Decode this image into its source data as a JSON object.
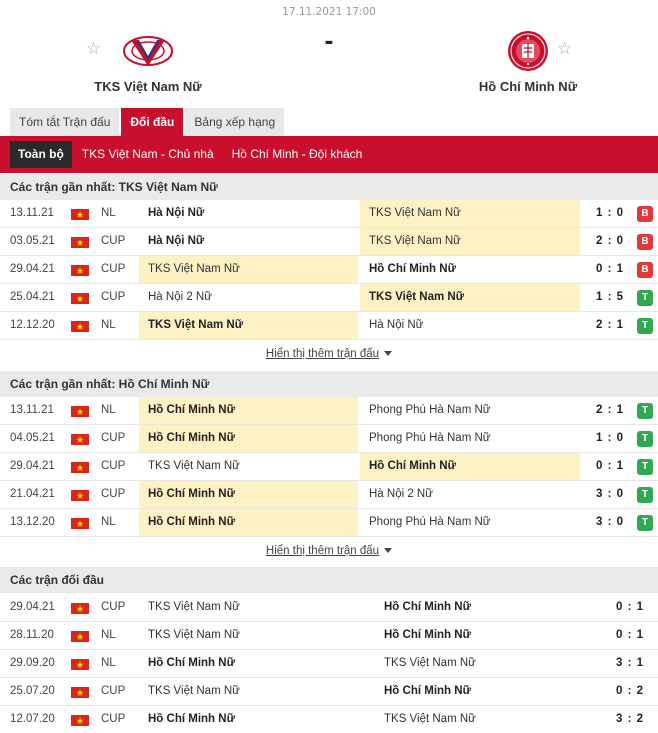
{
  "match": {
    "datetime": "17.11.2021 17:00",
    "score_separator": "-",
    "home": {
      "name": "TKS Việt Nam Nữ",
      "logo_icon": "tks-vietnam-crest-icon"
    },
    "away": {
      "name": "Hồ Chí Minh Nữ",
      "logo_icon": "hcm-football-club-crest-icon"
    }
  },
  "tabs": [
    {
      "label": "Tóm tắt Trận đấu",
      "active": false
    },
    {
      "label": "Đối đầu",
      "active": true
    },
    {
      "label": "Bảng xếp hạng",
      "active": false
    }
  ],
  "subtabs": [
    {
      "label": "Toàn bộ",
      "active": true
    },
    {
      "label": "TKS Việt Nam - Chủ nhà",
      "active": false
    },
    {
      "label": "Hồ Chí Minh - Đội khách",
      "active": false
    }
  ],
  "colors": {
    "accent": "#c8102e",
    "highlight": "#fcf2c4",
    "loss": "#e23a3a",
    "win": "#2fa84f"
  },
  "sections": {
    "home_recent": {
      "title": "Các trận gần nhất: TKS Việt Nam Nữ",
      "more_label": "Hiển thị thêm trận đấu",
      "rows": [
        {
          "date": "13.11.21",
          "comp": "NL",
          "home": "Hà Nội Nữ",
          "away": "TKS Việt Nam Nữ",
          "score": "1 : 0",
          "result": "B",
          "highlight": "away",
          "bold": "home"
        },
        {
          "date": "03.05.21",
          "comp": "CUP",
          "home": "Hà Nội Nữ",
          "away": "TKS Việt Nam Nữ",
          "score": "2 : 0",
          "result": "B",
          "highlight": "away",
          "bold": "home"
        },
        {
          "date": "29.04.21",
          "comp": "CUP",
          "home": "TKS Việt Nam Nữ",
          "away": "Hồ Chí Minh Nữ",
          "score": "0 : 1",
          "result": "B",
          "highlight": "home",
          "bold": "away"
        },
        {
          "date": "25.04.21",
          "comp": "CUP",
          "home": "Hà Nội 2 Nữ",
          "away": "TKS Việt Nam Nữ",
          "score": "1 : 5",
          "result": "T",
          "highlight": "away",
          "bold": "away"
        },
        {
          "date": "12.12.20",
          "comp": "NL",
          "home": "TKS Việt Nam Nữ",
          "away": "Hà Nội Nữ",
          "score": "2 : 1",
          "result": "T",
          "highlight": "home",
          "bold": "home"
        }
      ]
    },
    "away_recent": {
      "title": "Các trận gần nhất: Hồ Chí Minh Nữ",
      "more_label": "Hiển thị thêm trận đấu",
      "rows": [
        {
          "date": "13.11.21",
          "comp": "NL",
          "home": "Hồ Chí Minh Nữ",
          "away": "Phong Phú Hà Nam Nữ",
          "score": "2 : 1",
          "result": "T",
          "highlight": "home",
          "bold": "home"
        },
        {
          "date": "04.05.21",
          "comp": "CUP",
          "home": "Hồ Chí Minh Nữ",
          "away": "Phong Phú Hà Nam Nữ",
          "score": "1 : 0",
          "result": "T",
          "highlight": "home",
          "bold": "home"
        },
        {
          "date": "29.04.21",
          "comp": "CUP",
          "home": "TKS Việt Nam Nữ",
          "away": "Hồ Chí Minh Nữ",
          "score": "0 : 1",
          "result": "T",
          "highlight": "away",
          "bold": "away"
        },
        {
          "date": "21.04.21",
          "comp": "CUP",
          "home": "Hồ Chí Minh Nữ",
          "away": "Hà Nội 2 Nữ",
          "score": "3 : 0",
          "result": "T",
          "highlight": "home",
          "bold": "home"
        },
        {
          "date": "13.12.20",
          "comp": "NL",
          "home": "Hồ Chí Minh Nữ",
          "away": "Phong Phú Hà Nam Nữ",
          "score": "3 : 0",
          "result": "T",
          "highlight": "home",
          "bold": "home"
        }
      ]
    },
    "h2h": {
      "title": "Các trận đối đầu",
      "rows": [
        {
          "date": "29.04.21",
          "comp": "CUP",
          "home": "TKS Việt Nam Nữ",
          "away": "Hồ Chí Minh Nữ",
          "score": "0 : 1",
          "bold": "away"
        },
        {
          "date": "28.11.20",
          "comp": "NL",
          "home": "TKS Việt Nam Nữ",
          "away": "Hồ Chí Minh Nữ",
          "score": "0 : 1",
          "bold": "away"
        },
        {
          "date": "29.09.20",
          "comp": "NL",
          "home": "Hồ Chí Minh Nữ",
          "away": "TKS Việt Nam Nữ",
          "score": "3 : 1",
          "bold": "home"
        },
        {
          "date": "25.07.20",
          "comp": "CUP",
          "home": "TKS Việt Nam Nữ",
          "away": "Hồ Chí Minh Nữ",
          "score": "0 : 2",
          "bold": "away"
        },
        {
          "date": "12.07.20",
          "comp": "CUP",
          "home": "Hồ Chí Minh Nữ",
          "away": "TKS Việt Nam Nữ",
          "score": "3 : 2",
          "bold": "home"
        }
      ]
    }
  }
}
